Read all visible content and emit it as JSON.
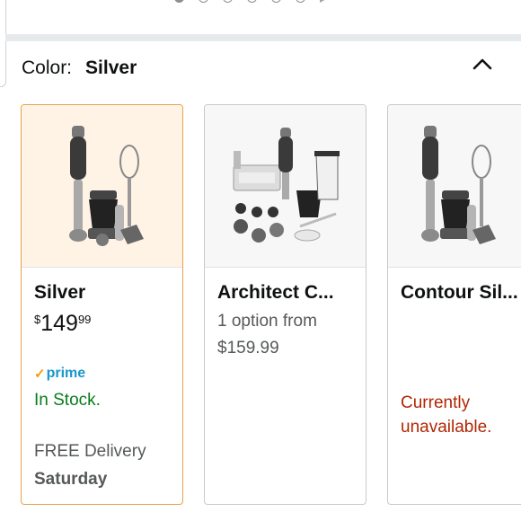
{
  "carousel": {
    "dots": 6,
    "active_index": 0
  },
  "color_selector": {
    "label": "Color:",
    "selected": "Silver"
  },
  "options": [
    {
      "name": "Silver",
      "price_symbol": "$",
      "price_whole": "149",
      "price_fraction": "99",
      "prime": "prime",
      "stock": "In Stock.",
      "delivery": "FREE Delivery",
      "delivery_day": "Saturday",
      "selected": true
    },
    {
      "name": "Architect C...",
      "subtitle_1": "1 option from",
      "subtitle_2": "$159.99",
      "selected": false
    },
    {
      "name": "Contour Sil...",
      "availability": "Currently unavailable.",
      "selected": false
    }
  ],
  "icons": {
    "collapse": "chevron-up-icon",
    "check": "check-icon"
  },
  "colors": {
    "selected_border": "#e7a24a",
    "selected_bg": "#fff3e6",
    "in_stock": "#067d19",
    "unavailable": "#b12704",
    "prime": "#1a98c9"
  }
}
